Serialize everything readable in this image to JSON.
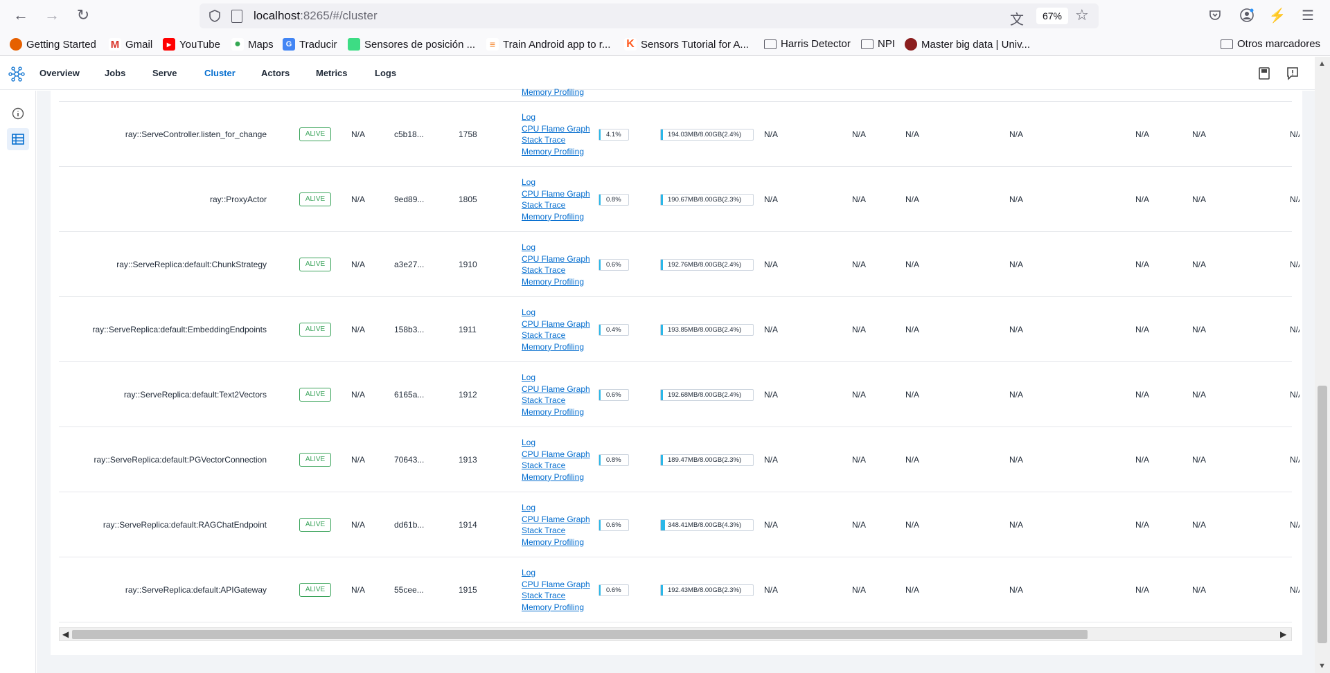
{
  "browser": {
    "url_host": "localhost",
    "url_rest": ":8265/#/cluster",
    "zoom": "67%",
    "bookmarks": [
      {
        "label": "Getting Started",
        "icon": "firefox-icon",
        "color": "#e66000"
      },
      {
        "label": "Gmail",
        "icon": "gmail-icon",
        "color": "#d93025"
      },
      {
        "label": "YouTube",
        "icon": "youtube-icon",
        "color": "#ff0000"
      },
      {
        "label": "Maps",
        "icon": "maps-icon",
        "color": "#34a853"
      },
      {
        "label": "Traducir",
        "icon": "translate-icon",
        "color": "#4285f4"
      },
      {
        "label": "Sensores de posición ...",
        "icon": "android-icon",
        "color": "#3ddc84"
      },
      {
        "label": "Train Android app to r...",
        "icon": "stackoverflow-icon",
        "color": "#f48024"
      },
      {
        "label": "Sensors Tutorial for A...",
        "icon": "k-icon",
        "color": "#ff5a1f"
      },
      {
        "label": "Harris Detector",
        "icon": "folder-icon"
      },
      {
        "label": "NPI",
        "icon": "folder-icon"
      },
      {
        "label": "Master big data | Univ...",
        "icon": "university-icon",
        "color": "#8b1e1e"
      },
      {
        "label": "Otros marcadores",
        "icon": "folder-icon"
      }
    ]
  },
  "app": {
    "tabs": [
      "Overview",
      "Jobs",
      "Serve",
      "Cluster",
      "Actors",
      "Metrics",
      "Logs"
    ],
    "active_tab": "Cluster",
    "accent": "#036dcf"
  },
  "table": {
    "top_partial_link": "Memory Profiling",
    "link_labels": [
      "Log",
      "CPU Flame Graph",
      "Stack Trace",
      "Memory Profiling"
    ],
    "na": "N/A",
    "na_cut": "N/.",
    "rows": [
      {
        "name": "ray::ServeController.listen_for_change",
        "state": "ALIVE",
        "col3": "N/A",
        "id": "c5b18...",
        "pid": "1758",
        "cpu": "4.1%",
        "cpu_pct": 4.1,
        "mem": "194.03MB/8.00GB(2.4%)",
        "mem_pct": 2.4
      },
      {
        "name": "ray::ProxyActor",
        "state": "ALIVE",
        "col3": "N/A",
        "id": "9ed89...",
        "pid": "1805",
        "cpu": "0.8%",
        "cpu_pct": 0.8,
        "mem": "190.67MB/8.00GB(2.3%)",
        "mem_pct": 2.3
      },
      {
        "name": "ray::ServeReplica:default:ChunkStrategy",
        "state": "ALIVE",
        "col3": "N/A",
        "id": "a3e27...",
        "pid": "1910",
        "cpu": "0.6%",
        "cpu_pct": 0.6,
        "mem": "192.76MB/8.00GB(2.4%)",
        "mem_pct": 2.4
      },
      {
        "name": "ray::ServeReplica:default:EmbeddingEndpoints",
        "state": "ALIVE",
        "col3": "N/A",
        "id": "158b3...",
        "pid": "1911",
        "cpu": "0.4%",
        "cpu_pct": 0.4,
        "mem": "193.85MB/8.00GB(2.4%)",
        "mem_pct": 2.4
      },
      {
        "name": "ray::ServeReplica:default:Text2Vectors",
        "state": "ALIVE",
        "col3": "N/A",
        "id": "6165a...",
        "pid": "1912",
        "cpu": "0.6%",
        "cpu_pct": 0.6,
        "mem": "192.68MB/8.00GB(2.4%)",
        "mem_pct": 2.4
      },
      {
        "name": "ray::ServeReplica:default:PGVectorConnection",
        "state": "ALIVE",
        "col3": "N/A",
        "id": "70643...",
        "pid": "1913",
        "cpu": "0.8%",
        "cpu_pct": 0.8,
        "mem": "189.47MB/8.00GB(2.3%)",
        "mem_pct": 2.3
      },
      {
        "name": "ray::ServeReplica:default:RAGChatEndpoint",
        "state": "ALIVE",
        "col3": "N/A",
        "id": "dd61b...",
        "pid": "1914",
        "cpu": "0.6%",
        "cpu_pct": 0.6,
        "mem": "348.41MB/8.00GB(4.3%)",
        "mem_pct": 4.3
      },
      {
        "name": "ray::ServeReplica:default:APIGateway",
        "state": "ALIVE",
        "col3": "N/A",
        "id": "55cee...",
        "pid": "1915",
        "cpu": "0.6%",
        "cpu_pct": 0.6,
        "mem": "192.43MB/8.00GB(2.3%)",
        "mem_pct": 2.3
      }
    ]
  },
  "colors": {
    "alive": "#3aa35a",
    "usage_bar": "#2ab7e8",
    "link": "#036dcf"
  }
}
